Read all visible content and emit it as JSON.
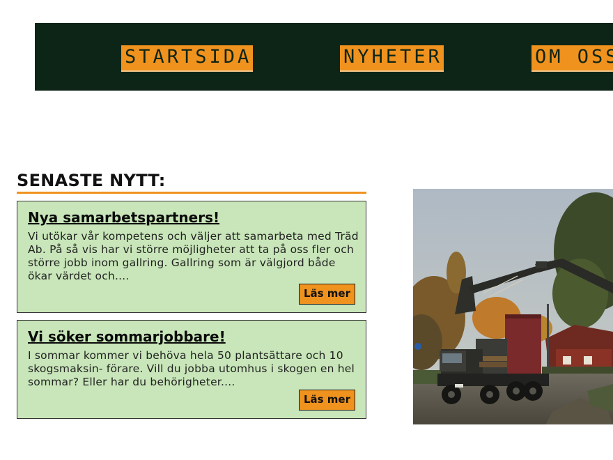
{
  "nav": {
    "items": [
      {
        "label": "STARTSIDA"
      },
      {
        "label": "NYHETER"
      },
      {
        "label": "OM OSS"
      }
    ]
  },
  "news": {
    "heading": "SENASTE NYTT:",
    "cards": [
      {
        "title": "Nya samarbetspartners!",
        "text": "Vi utökar vår kompetens och väljer att samarbeta med Träd Ab. På så vis har vi större möjligheter att ta på oss fler och större jobb inom gallring. Gallring som är välgjord både ökar värdet och....",
        "button": "Läs mer"
      },
      {
        "title": "Vi söker sommarjobbare!",
        "text": "I sommar kommer vi behöva hela 50 plantsättare och 10 skogsmaksin- förare. Vill du jobba utomhus i skogen en hel sommar? Eller har du behörigheter....",
        "button": "Läs mer"
      }
    ]
  },
  "photo": {
    "subject": "forestry-crane-truck-photo"
  },
  "colors": {
    "nav_bg": "#0d2516",
    "accent_orange": "#f0921e",
    "card_bg": "#c8e6b9"
  }
}
